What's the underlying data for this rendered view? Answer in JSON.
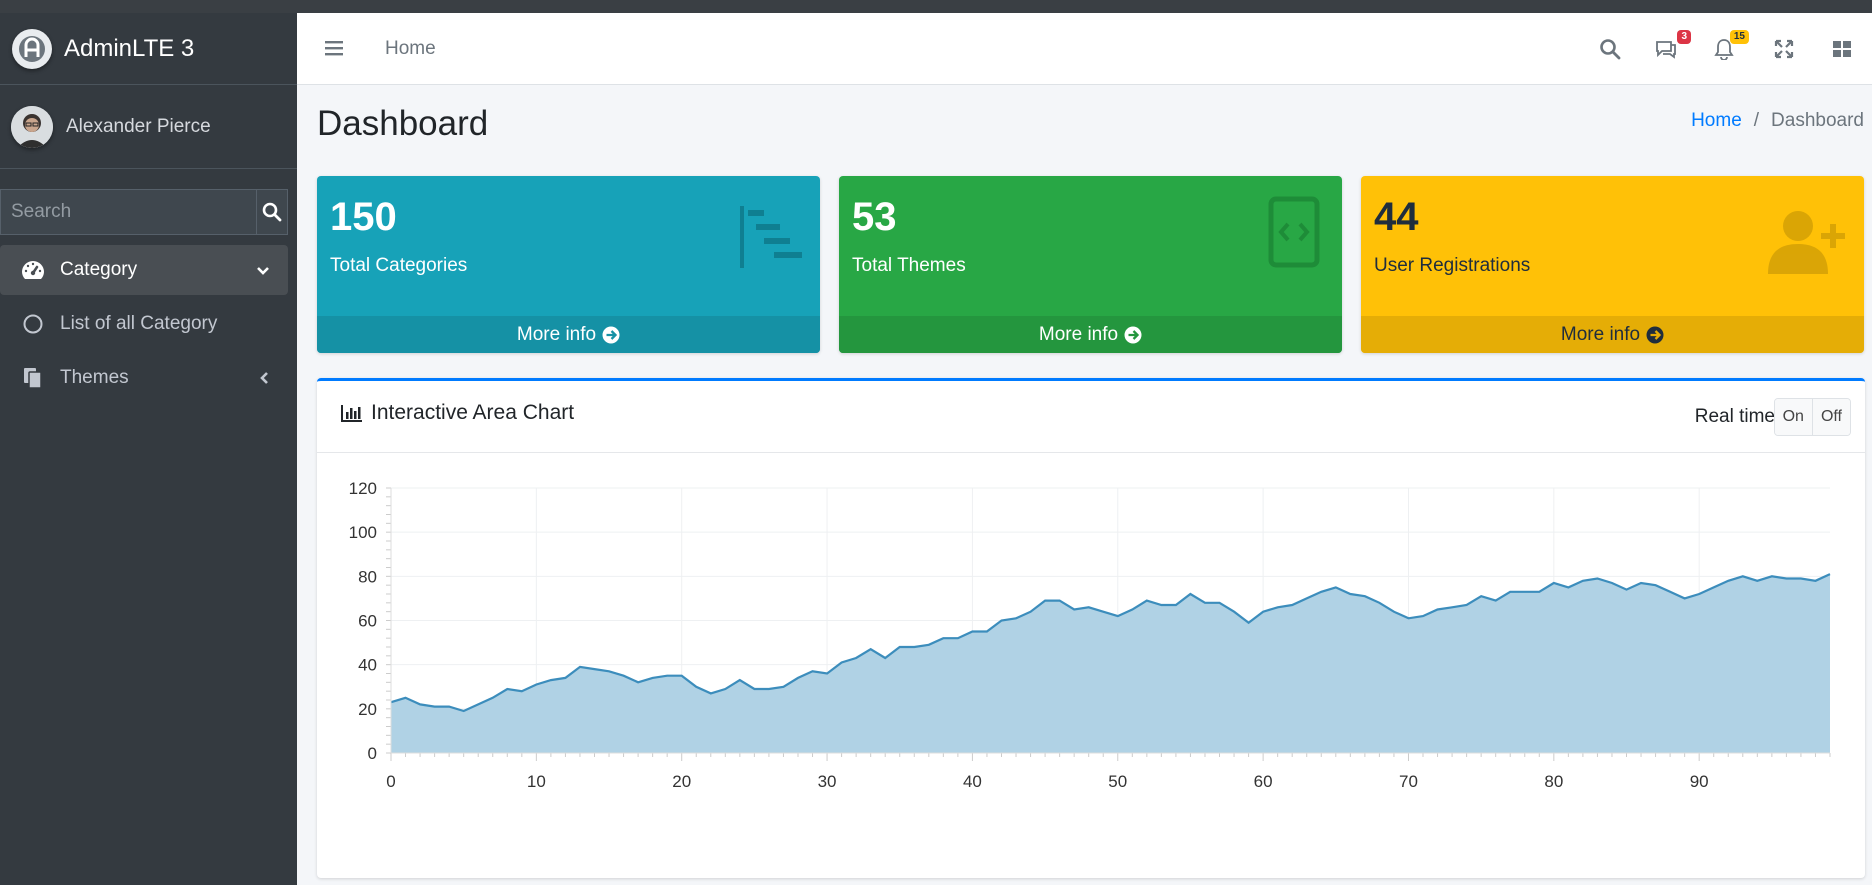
{
  "brand": {
    "name": "AdminLTE 3"
  },
  "user": {
    "name": "Alexander Pierce"
  },
  "sidebar": {
    "search_placeholder": "Search",
    "items": [
      {
        "label": "Category",
        "icon": "tachometer-icon",
        "active": true
      },
      {
        "label": "List of all Category",
        "icon": "circle-icon"
      },
      {
        "label": "Themes",
        "icon": "copy-icon"
      }
    ]
  },
  "navbar": {
    "home_link": "Home",
    "messages_count": "3",
    "notifications_count": "15"
  },
  "header": {
    "title": "Dashboard",
    "breadcrumb": {
      "home": "Home",
      "separator": "/",
      "current": "Dashboard"
    }
  },
  "stats": [
    {
      "value": "150",
      "label": "Total Categories",
      "footer": "More info",
      "color": "#17a2b8",
      "footer_color": "#1591a5",
      "icon": "tasks-icon"
    },
    {
      "value": "53",
      "label": "Total Themes",
      "footer": "More info",
      "color": "#28a745",
      "footer_color": "#24963e",
      "icon": "code-icon"
    },
    {
      "value": "44",
      "label": "User Registrations",
      "footer": "More info",
      "color": "#ffc107",
      "footer_color": "#e5ad06",
      "icon": "user-plus-icon"
    }
  ],
  "chart_card": {
    "title": "Interactive Area Chart",
    "realtime_label": "Real time",
    "toggle_on": "On",
    "toggle_off": "Off"
  },
  "colors": {
    "accent": "#007bff",
    "sidebar_bg": "#343a40",
    "area_fill": "#b0d2e5",
    "area_line": "#3c8dbc"
  },
  "chart_data": {
    "type": "area",
    "x_ticks": [
      0,
      10,
      20,
      30,
      40,
      50,
      60,
      70,
      80,
      90
    ],
    "y_ticks": [
      0,
      20,
      40,
      60,
      80,
      100,
      120
    ],
    "xlim": [
      0,
      99
    ],
    "ylim": [
      0,
      120
    ],
    "grid": true,
    "series": [
      {
        "values": [
          23,
          25,
          22,
          21,
          21,
          19,
          22,
          25,
          29,
          28,
          31,
          33,
          34,
          39,
          38,
          37,
          35,
          32,
          34,
          35,
          35,
          30,
          27,
          29,
          33,
          29,
          29,
          30,
          34,
          37,
          36,
          41,
          43,
          47,
          43,
          48,
          48,
          49,
          52,
          52,
          55,
          55,
          60,
          61,
          64,
          69,
          69,
          65,
          66,
          64,
          62,
          65,
          69,
          67,
          67,
          72,
          68,
          68,
          64,
          59,
          64,
          66,
          67,
          70,
          73,
          75,
          72,
          71,
          68,
          64,
          61,
          62,
          65,
          66,
          67,
          71,
          69,
          73,
          73,
          73,
          77,
          75,
          78,
          79,
          77,
          74,
          77,
          76,
          73,
          70,
          72,
          75,
          78,
          80,
          78,
          80,
          79,
          79,
          78,
          81
        ]
      }
    ]
  }
}
